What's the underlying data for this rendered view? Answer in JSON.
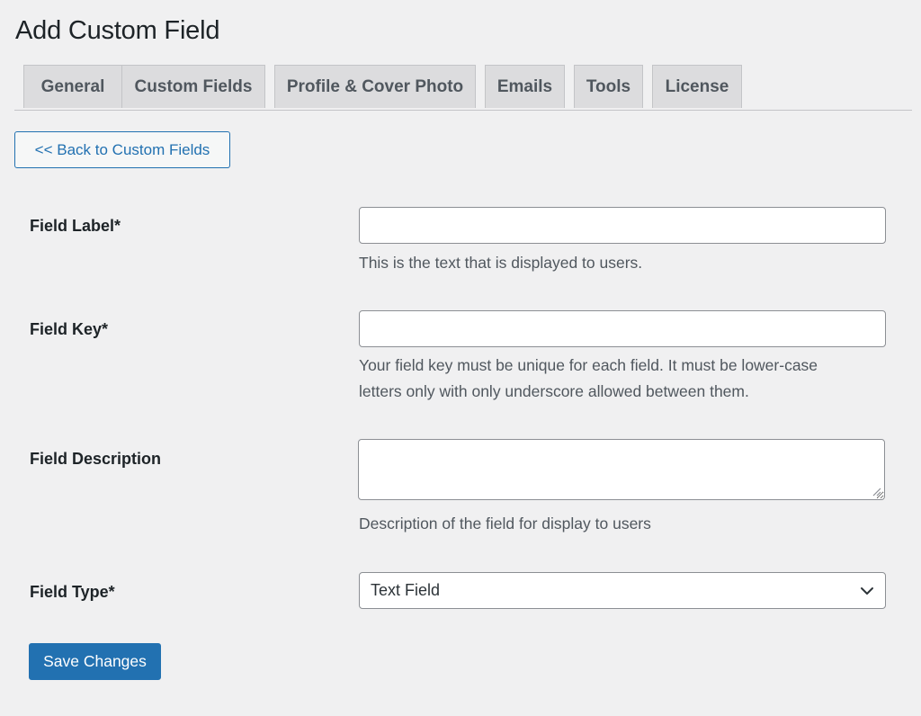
{
  "page": {
    "title": "Add Custom Field"
  },
  "tabs": [
    {
      "label": "General"
    },
    {
      "label": "Custom Fields"
    },
    {
      "label": "Profile & Cover Photo"
    },
    {
      "label": "Emails"
    },
    {
      "label": "Tools"
    },
    {
      "label": "License"
    }
  ],
  "back_button": {
    "label": "<< Back to Custom Fields"
  },
  "form": {
    "field_label": {
      "label": "Field Label*",
      "value": "",
      "help": "This is the text that is displayed to users."
    },
    "field_key": {
      "label": "Field Key*",
      "value": "",
      "help_line1": "Your field key must be unique for each field. It must be lower-case",
      "help_line2": "letters only with only underscore allowed between them."
    },
    "field_description": {
      "label": "Field Description",
      "value": "",
      "help": "Description of the field for display to users"
    },
    "field_type": {
      "label": "Field Type*",
      "selected": "Text Field",
      "icon": "chevron-down-icon"
    }
  },
  "save_button": {
    "label": "Save Changes"
  },
  "colors": {
    "background": "#f0f0f1",
    "accent": "#2271b1",
    "tab_bg": "#dcdcde",
    "muted_text": "#50575e"
  }
}
